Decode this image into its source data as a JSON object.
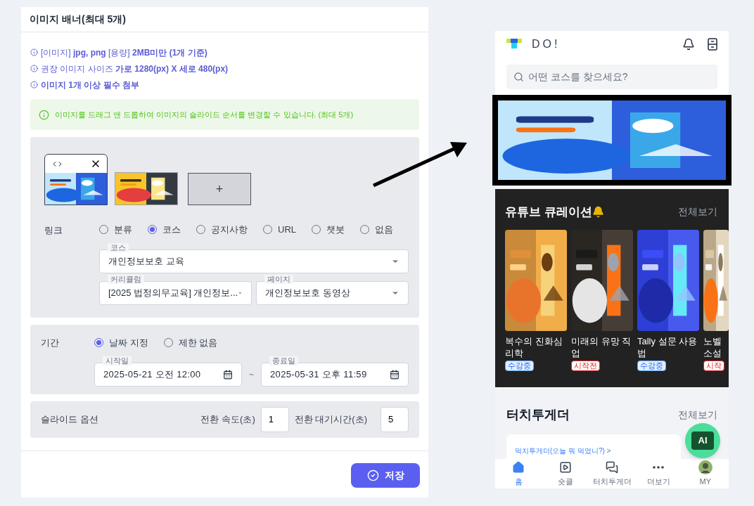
{
  "banner_editor": {
    "title": "이미지 배너(최대 5개)",
    "info_lines": [
      "[이미지] **jpg, png** [용량] **2MB미만 (1개 기준)**",
      "권장 이미지 사이즈 **가로 1280(px) X 세로 480(px)**",
      "**이미지 1개 이상 필수 첨부**"
    ],
    "notice": "이미지를 드래그 앤 드롭하여 이미지의 슬라이드 순서를 변경할 수 있습니다. (최대 5개)",
    "images": [
      {
        "kind": "picture",
        "hovered": true
      },
      {
        "kind": "picture",
        "hovered": false
      }
    ],
    "add_tile": "+",
    "link": {
      "label": "링크",
      "options": [
        {
          "label": "분류",
          "selected": false
        },
        {
          "label": "코스",
          "selected": true
        },
        {
          "label": "공지사항",
          "selected": false
        },
        {
          "label": "URL",
          "selected": false
        },
        {
          "label": "챗봇",
          "selected": false
        },
        {
          "label": "없음",
          "selected": false
        }
      ],
      "fields": [
        {
          "label": "코스",
          "value": "개인정보보호 교육"
        },
        {
          "label": "커리큘럼",
          "value": "[2025 법정의무교육] 개인정보..."
        },
        {
          "label": "페이지",
          "value": "개인정보보호 동영상"
        }
      ]
    },
    "period": {
      "label": "기간",
      "options": [
        {
          "label": "날짜 지정",
          "selected": true
        },
        {
          "label": "제한 없음",
          "selected": false
        }
      ],
      "start": {
        "label": "시작일",
        "value": "2025-05-21 오전 12:00"
      },
      "separator": "~",
      "end": {
        "label": "종료일",
        "value": "2025-05-31 오후 11:59"
      }
    },
    "slide_options": {
      "label": "슬라이드 옵션",
      "speed": {
        "label": "전환 속도(초)",
        "value": "1"
      },
      "wait": {
        "label": "전환 대기시간(초)",
        "value": "5"
      }
    },
    "save_button": "저장"
  },
  "phone": {
    "logo_text": "DO!",
    "search_placeholder": "어떤 코스를 찾으세요?",
    "banner": {
      "kind": "picture"
    },
    "youtube": {
      "title": "유튜브 큐레이션",
      "more": "전체보기",
      "cards": [
        {
          "title": "복수의 진화심리학",
          "badge": "수강중",
          "kind": "ongoing"
        },
        {
          "title": "미래의 유망 직업",
          "badge": "시작전",
          "kind": "upcoming"
        },
        {
          "title": "Tally 설문 사용법",
          "badge": "수강중",
          "kind": "ongoing"
        },
        {
          "title": "노벨 소설",
          "badge": "시작",
          "kind": "upcoming"
        }
      ]
    },
    "together": {
      "title": "터치투게더",
      "more": "전체보기",
      "cards": [
        {
          "link": "먹치투게더(오늘 뭐 먹었니?) >"
        }
      ]
    },
    "ai_button": "AI",
    "nav": [
      {
        "label": "홈",
        "kind": "home",
        "selected": true
      },
      {
        "label": "숏클",
        "kind": "shorts",
        "selected": false
      },
      {
        "label": "터치투게더",
        "kind": "chat",
        "selected": false
      },
      {
        "label": "더보기",
        "kind": "more",
        "selected": false
      },
      {
        "label": "MY",
        "kind": "avatar",
        "selected": false
      }
    ]
  }
}
